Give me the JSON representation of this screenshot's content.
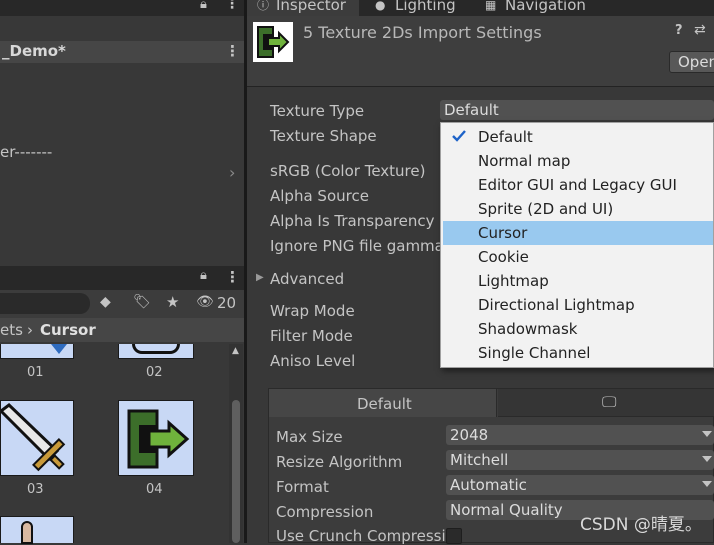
{
  "tabs": {
    "inspector": "Inspector",
    "lighting": "Lighting",
    "navigation": "Navigation"
  },
  "header": {
    "title": "5 Texture 2Ds Import Settings",
    "open_label": "Open"
  },
  "left": {
    "scene_title": "_Demo*",
    "scene_text": "er-------",
    "search_count": "20",
    "breadcrumb_parent": "ets",
    "breadcrumb_current": "Cursor",
    "assets": [
      {
        "label": "01"
      },
      {
        "label": "02"
      },
      {
        "label": "03"
      },
      {
        "label": "04"
      }
    ]
  },
  "settings": {
    "texture_type_label": "Texture Type",
    "texture_type_value": "Default",
    "texture_shape_label": "Texture Shape",
    "srgb_label": "sRGB (Color Texture)",
    "alpha_source_label": "Alpha Source",
    "alpha_transparency_label": "Alpha Is Transparency",
    "ignore_png_label": "Ignore PNG file gamma",
    "advanced_label": "Advanced",
    "wrap_mode_label": "Wrap Mode",
    "filter_mode_label": "Filter Mode",
    "aniso_level_label": "Aniso Level"
  },
  "dropdown": {
    "items": [
      {
        "label": "Default",
        "checked": true
      },
      {
        "label": "Normal map"
      },
      {
        "label": "Editor GUI and Legacy GUI"
      },
      {
        "label": "Sprite (2D and UI)"
      },
      {
        "label": "Cursor",
        "highlighted": true
      },
      {
        "label": "Cookie"
      },
      {
        "label": "Lightmap"
      },
      {
        "label": "Directional Lightmap"
      },
      {
        "label": "Shadowmask"
      },
      {
        "label": "Single Channel"
      }
    ]
  },
  "platform": {
    "tab_default": "Default",
    "max_size_label": "Max Size",
    "max_size_value": "2048",
    "resize_label": "Resize Algorithm",
    "resize_value": "Mitchell",
    "format_label": "Format",
    "format_value": "Automatic",
    "compression_label": "Compression",
    "compression_value": "Normal Quality",
    "crunch_label": "Use Crunch Compressic"
  },
  "watermark": "CSDN @晴夏。",
  "colors": {
    "accent_green": "#3c6e2a",
    "highlight": "#99c9ef",
    "thumb_bg": "#c8d8f5"
  }
}
